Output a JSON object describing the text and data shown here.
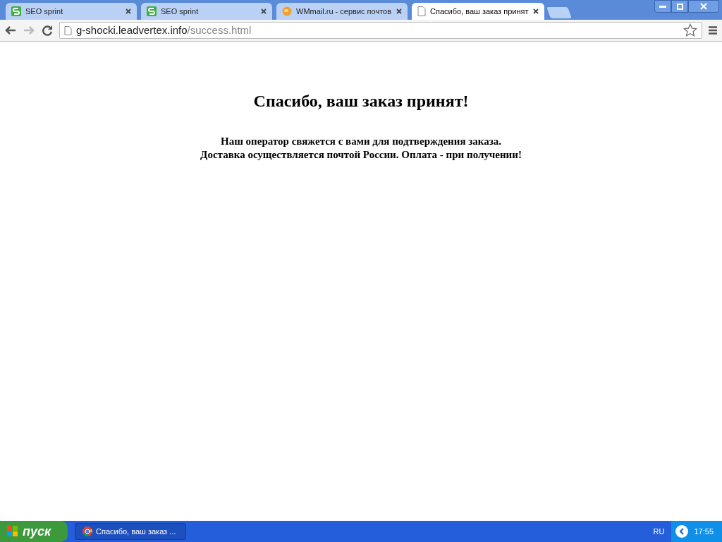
{
  "tabs": [
    {
      "title": "SEO sprint",
      "kind": "seo",
      "selected": false
    },
    {
      "title": "SEO sprint",
      "kind": "seo",
      "selected": false
    },
    {
      "title": "WMmail.ru - сервис почтов",
      "kind": "mail",
      "selected": false
    },
    {
      "title": "Спасибо, ваш заказ принят",
      "kind": "page",
      "selected": true
    }
  ],
  "address": {
    "host": "g-shocki.leadvertex.info",
    "path": "/success.html"
  },
  "page": {
    "heading": "Спасибо, ваш заказ принят!",
    "lines": [
      "Наш оператор свяжется с вами для подтверждения заказа.",
      "Доставка осуществляется почтой России. Оплата - при получении!"
    ]
  },
  "taskbar": {
    "start": "пуск",
    "task": "Спасибо, ваш заказ ...",
    "language": "RU",
    "clock": "17:55"
  }
}
